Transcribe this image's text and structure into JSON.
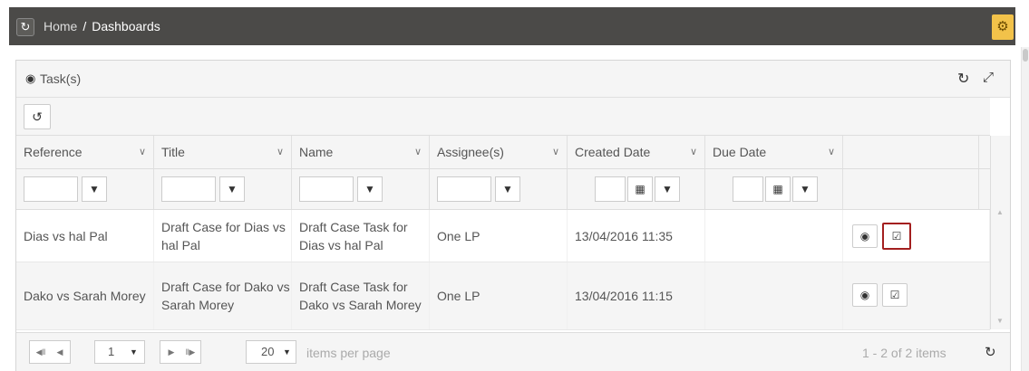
{
  "breadcrumb": {
    "home": "Home",
    "separator": "/",
    "current": "Dashboards"
  },
  "panel": {
    "title": "Task(s)"
  },
  "icons": {
    "app": "refresh-logo-icon",
    "settings": "gear-icon",
    "panel": "dashboard-icon",
    "panel_refresh": "refresh-icon",
    "panel_expand": "expand-icon",
    "reload": "undo-icon",
    "filter": "filter-icon",
    "calendar": "calendar-icon",
    "view": "eye-icon",
    "complete": "checkbox-icon"
  },
  "columns": [
    {
      "label": "Reference"
    },
    {
      "label": "Title"
    },
    {
      "label": "Name"
    },
    {
      "label": "Assignee(s)"
    },
    {
      "label": "Created Date"
    },
    {
      "label": "Due Date"
    },
    {
      "label": ""
    }
  ],
  "rows": [
    {
      "reference": "Dias vs hal Pal",
      "title": "Draft Case for Dias vs hal Pal",
      "name": "Draft Case Task for Dias vs hal Pal",
      "assignees": "One LP",
      "created": "13/04/2016 11:35",
      "due": ""
    },
    {
      "reference": "Dako vs Sarah Morey",
      "title": "Draft Case for Dako vs Sarah Morey",
      "name": "Draft Case Task for Dako vs Sarah Morey",
      "assignees": "One LP",
      "created": "13/04/2016 11:15",
      "due": ""
    }
  ],
  "pager": {
    "page": "1",
    "page_size": "20",
    "items_per_page_label": "items per page",
    "summary": "1 - 2 of 2 items"
  },
  "colors": {
    "topbar": "#4b4a48",
    "gear_button": "#f2c24a",
    "highlight": "#a31f1f"
  }
}
